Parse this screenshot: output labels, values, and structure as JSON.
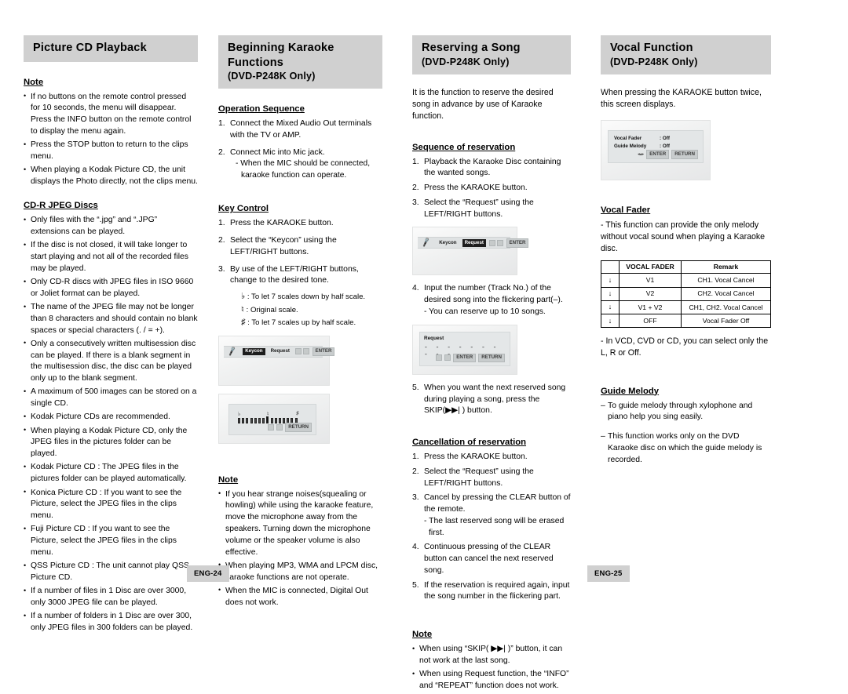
{
  "columns": {
    "picture_cd": {
      "banner_title": "Picture CD Playback",
      "note_heading": "Note",
      "notes": [
        "If no buttons on the remote control pressed for 10 seconds, the menu will disappear. Press the INFO button on the remote control to display the menu again.",
        "Press the STOP button to return to the clips menu.",
        "When playing a Kodak Picture CD, the unit displays the Photo directly, not the clips menu."
      ],
      "cdr_heading": "CD-R JPEG Discs",
      "cdr_items": [
        "Only files with the “.jpg” and “.JPG” extensions can be played.",
        "If the disc is not closed, it will take longer to start playing and not all of the recorded files may be played.",
        "Only CD-R discs with JPEG files in ISO 9660 or Joliet format can be played.",
        "The name of the JPEG file may not be longer than 8 characters and should contain no blank spaces or special characters (. / = +).",
        "Only a consecutively written multisession disc can be played. If there is a blank segment in the multisession disc, the disc can be played only up to the blank segment.",
        "A maximum of 500 images can be stored on a single CD.",
        "Kodak Picture CDs are recommended.",
        "When playing a Kodak Picture CD, only the JPEG files in the pictures folder can be played.",
        "Kodak Picture CD : The JPEG files in the pictures folder can be played automatically.",
        "Konica Picture CD : If you want to see the Picture, select the JPEG files in the clips menu.",
        "Fuji Picture CD : If you want to see the Picture, select the JPEG files in the clips menu.",
        "QSS Picture CD : The unit cannot play QSS Picture CD.",
        "If a number of files in 1 Disc are over 3000, only 3000 JPEG file can be played.",
        "If a number of folders in 1 Disc are over 300, only JPEG files in 300 folders can be played."
      ]
    },
    "karaoke": {
      "banner_title": "Beginning Karaoke Functions",
      "banner_sub": "(DVD-P248K Only)",
      "operation_heading": "Operation Sequence",
      "operation_steps": [
        "Connect the Mixed Audio Out terminals with the TV or AMP.",
        "Connect Mic into Mic jack."
      ],
      "operation_sub_2": "- When the MIC should be connected, karaoke function can operate.",
      "key_control_heading": "Key Control",
      "key_control_steps": [
        "Press the KARAOKE button.",
        "Select the “Keycon” using the LEFT/RIGHT buttons.",
        "By use of the LEFT/RIGHT buttons, change to the desired tone."
      ],
      "scale_items": [
        {
          "symbol": "♭",
          "text": ": To let 7 scales down by half scale."
        },
        {
          "symbol": "♮",
          "text": ": Original scale."
        },
        {
          "symbol": "♯",
          "text": ": To let 7 scales up by half scale."
        }
      ],
      "osd_keycon": {
        "mic_icon": "mic-icon",
        "item_selected": "Keycon",
        "item_other": "Request",
        "enter_label": "ENTER"
      },
      "osd_scale": {
        "return_label": "RETURN",
        "symbols": [
          "♭",
          "♮",
          "♯"
        ]
      },
      "note_heading": "Note",
      "notes": [
        "If you hear strange noises(squealing or howling) while using the karaoke feature, move the microphone away from the speakers. Turning down the microphone volume or the speaker volume is also effective.",
        "When playing MP3, WMA and LPCM disc, karaoke functions are not operate.",
        "When the MIC is connected, Digital Out does not work."
      ]
    },
    "reserving": {
      "banner_title": "Reserving a Song",
      "banner_sub": "(DVD-P248K Only)",
      "intro": "It is the function to reserve the desired song in advance by use of Karaoke function.",
      "sequence_heading": "Sequence of reservation",
      "sequence_steps": [
        "Playback the Karaoke Disc containing the wanted songs.",
        "Press the KARAOKE button.",
        "Select the “Request” using the LEFT/RIGHT buttons.",
        "Input the number (Track No.) of the desired song into the flickering part(–).",
        "When you want the next reserved song during playing a song, press the SKIP(▶▶| ) button."
      ],
      "step4_sub": "- You can reserve up to 10 songs.",
      "osd_request_bar": {
        "mic_icon": "mic-icon",
        "item_other": "Keycon",
        "item_selected": "Request",
        "enter_label": "ENTER"
      },
      "osd_request_panel": {
        "title": "Request",
        "dashes": "- - - - - - - - - -",
        "btn1": "ENTER",
        "btn2": "RETURN"
      },
      "cancel_heading": "Cancellation of reservation",
      "cancel_steps": [
        "Press the KARAOKE button.",
        "Select the “Request” using the LEFT/RIGHT buttons.",
        "Cancel by pressing the CLEAR button of the remote.",
        "Continuous pressing of the CLEAR button can cancel the next reserved song.",
        "If the reservation is required again, input the song number in the flickering part."
      ],
      "cancel_step3_sub": "- The last reserved song will be erased first.",
      "note_heading": "Note",
      "notes": [
        "When using “SKIP( ▶▶| )” button, it can not work at the last song.",
        "When using Request function, the “INFO” and “REPEAT” function does not work."
      ]
    },
    "vocal": {
      "banner_title": "Vocal Function",
      "banner_sub": "(DVD-P248K Only)",
      "intro": "When pressing the KARAOKE button twice, this screen displays.",
      "osd_vocal": {
        "row1_label": "Vocal  Fader",
        "row1_value": ": Off",
        "row2_label": "Guide  Melody",
        "row2_value": ": Off",
        "btn1": "ENTER",
        "btn2": "RETURN"
      },
      "fader_heading": "Vocal Fader",
      "fader_desc": "- This function can provide the only melody without vocal sound when playing a Karaoke disc.",
      "fader_table": {
        "headers": [
          "",
          "VOCAL FADER",
          "Remark"
        ],
        "rows": [
          {
            "arrow": "↓",
            "value": "V1",
            "remark": "CH1. Vocal Cancel"
          },
          {
            "arrow": "↓",
            "value": "V2",
            "remark": "CH2. Vocal Cancel"
          },
          {
            "arrow": "↓",
            "value": "V1 + V2",
            "remark": "CH1, CH2. Vocal Cancel"
          },
          {
            "arrow": "↓",
            "value": "OFF",
            "remark": "Vocal Fader Off"
          }
        ]
      },
      "fader_note": "- In VCD, CVD or CD, you can select only the L, R or Off.",
      "guide_heading": "Guide Melody",
      "guide_items": [
        "To guide melody through xylophone and piano help you sing easily.",
        "This function works only on the DVD Karaoke disc on which the guide melody is recorded."
      ]
    }
  },
  "footer": {
    "page_left": "ENG-24",
    "page_right": "ENG-25"
  },
  "colors": {
    "banner_bg": "#d0d0d0",
    "text": "#000000"
  }
}
